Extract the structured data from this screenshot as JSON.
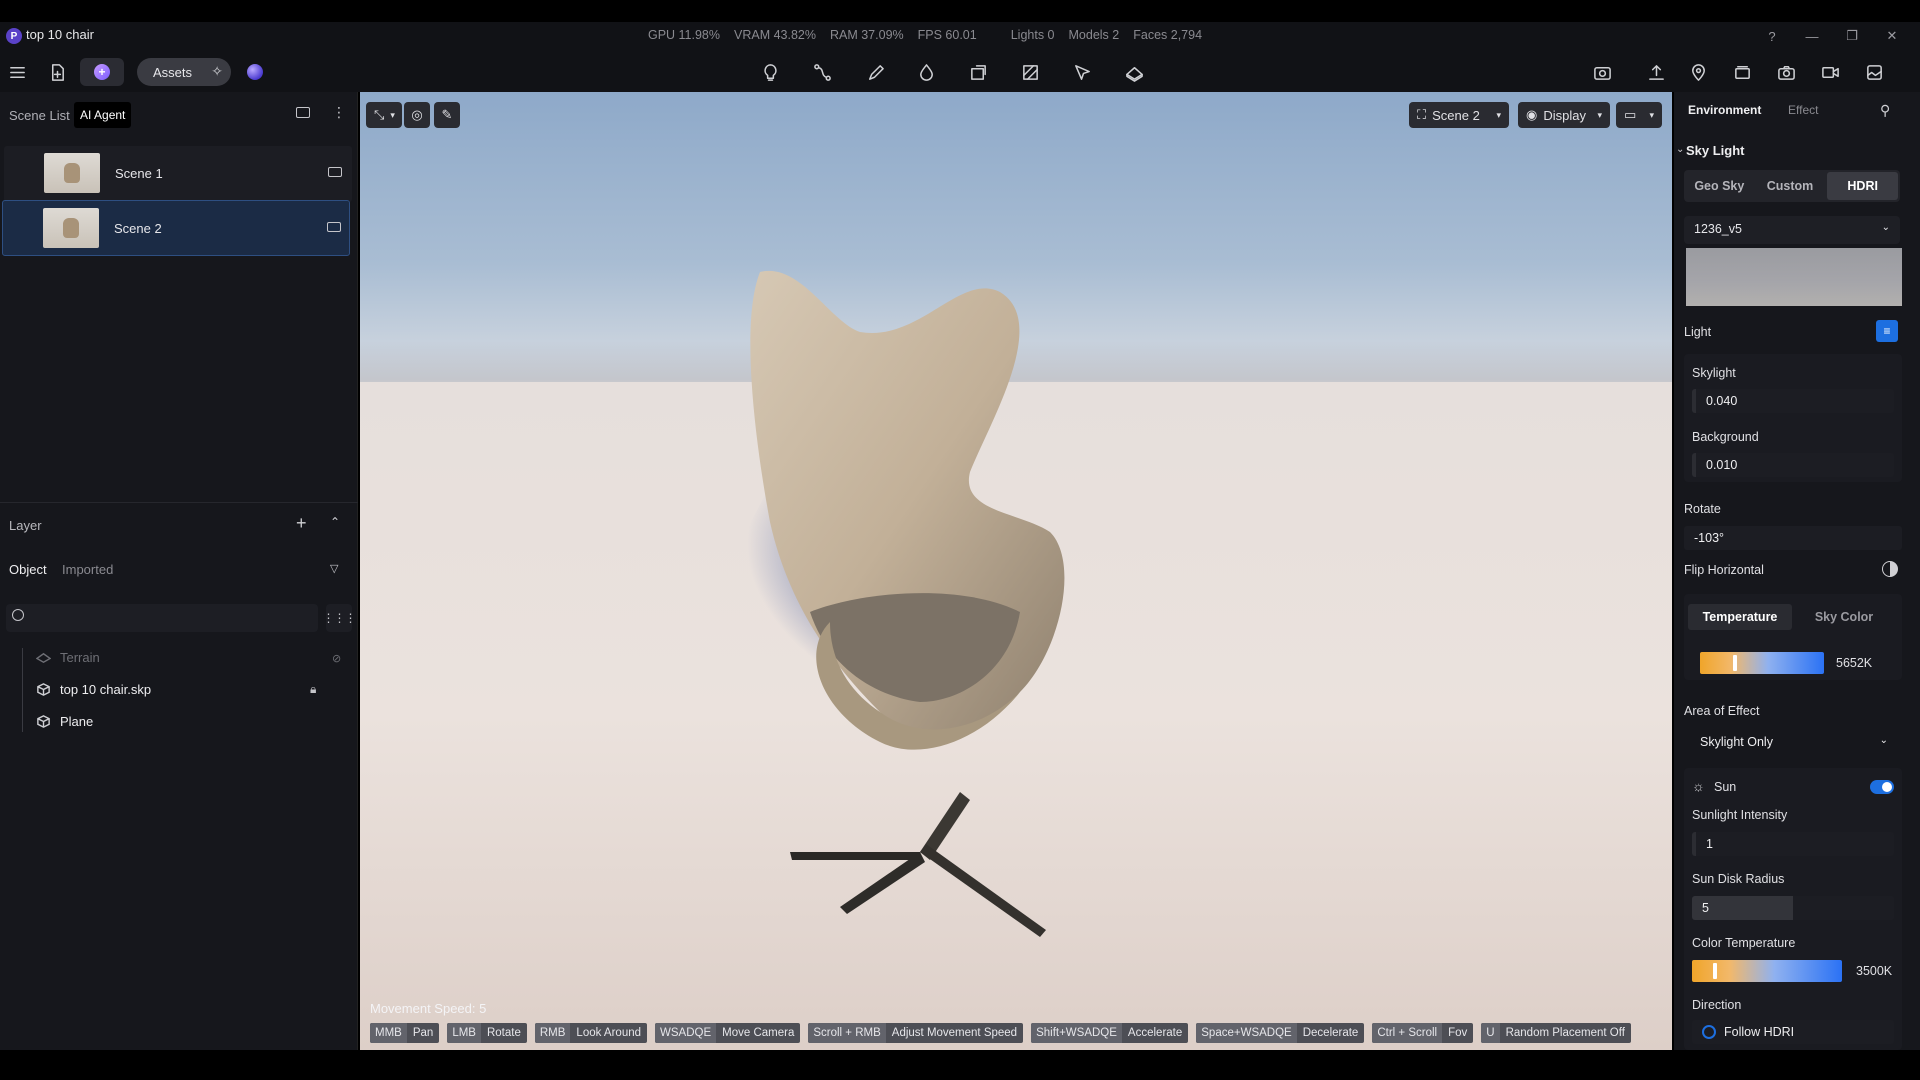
{
  "window": {
    "title": "top 10 chair",
    "logo_letter": "P"
  },
  "stats": {
    "gpu": "GPU 11.98%",
    "vram": "VRAM 43.82%",
    "ram": "RAM 37.09%",
    "fps": "FPS 60.01",
    "lights": "Lights 0",
    "models": "Models 2",
    "faces": "Faces 2,794"
  },
  "toolbar": {
    "assets_label": "Assets"
  },
  "left_panel": {
    "tabs": {
      "scene_list": "Scene List",
      "ai_agent": "AI Agent"
    },
    "scenes": [
      {
        "name": "Scene 1",
        "selected": false
      },
      {
        "name": "Scene 2",
        "selected": true
      }
    ],
    "layer_title": "Layer",
    "subtabs": {
      "object": "Object",
      "imported": "Imported"
    },
    "tree": [
      {
        "name": "Terrain",
        "hidden": true
      },
      {
        "name": "top 10 chair.skp",
        "locked": true
      },
      {
        "name": "Plane"
      }
    ]
  },
  "viewport": {
    "scene_select": "Scene 2",
    "display_label": "Display",
    "movement_speed": "Movement Speed: 5",
    "hints": [
      {
        "key": "MMB",
        "action": "Pan"
      },
      {
        "key": "LMB",
        "action": "Rotate"
      },
      {
        "key": "RMB",
        "action": "Look Around"
      },
      {
        "key": "WSADQE",
        "action": "Move Camera"
      },
      {
        "key": "Scroll + RMB",
        "action": "Adjust Movement Speed"
      },
      {
        "key": "Shift+WSADQE",
        "action": "Accelerate"
      },
      {
        "key": "Space+WSADQE",
        "action": "Decelerate"
      },
      {
        "key": "Ctrl + Scroll",
        "action": "Fov"
      },
      {
        "key": "U",
        "action": "Random Placement Off"
      }
    ]
  },
  "right_panel": {
    "tabs": {
      "environment": "Environment",
      "effect": "Effect"
    },
    "sky_light_title": "Sky Light",
    "sky_modes": [
      "Geo Sky",
      "Custom",
      "HDRI"
    ],
    "active_sky_mode": "HDRI",
    "hdri_value": "1236_v5",
    "light_label": "Light",
    "skylight_label": "Skylight",
    "skylight_value": "0.040",
    "background_label": "Background",
    "background_value": "0.010",
    "rotate_label": "Rotate",
    "rotate_value": "-103°",
    "flip_label": "Flip Horizontal",
    "temp_tabs": [
      "Temperature",
      "Sky Color"
    ],
    "temperature_value": "5652K",
    "temperature_fraction": 0.27,
    "area_label": "Area of Effect",
    "area_value": "Skylight Only",
    "sun_label": "Sun",
    "sun_enabled": true,
    "sunlight_intensity_label": "Sunlight Intensity",
    "sunlight_intensity_value": "1",
    "sun_disk_label": "Sun Disk Radius",
    "sun_disk_value": "5",
    "color_temp_label": "Color Temperature",
    "color_temp_value": "3500K",
    "color_temp_fraction": 0.14,
    "direction_label": "Direction",
    "follow_hdri_label": "Follow HDRI"
  },
  "colors": {
    "accent": "#1d6fe0",
    "selection": "#1b2b45",
    "panel": "#16171c"
  }
}
